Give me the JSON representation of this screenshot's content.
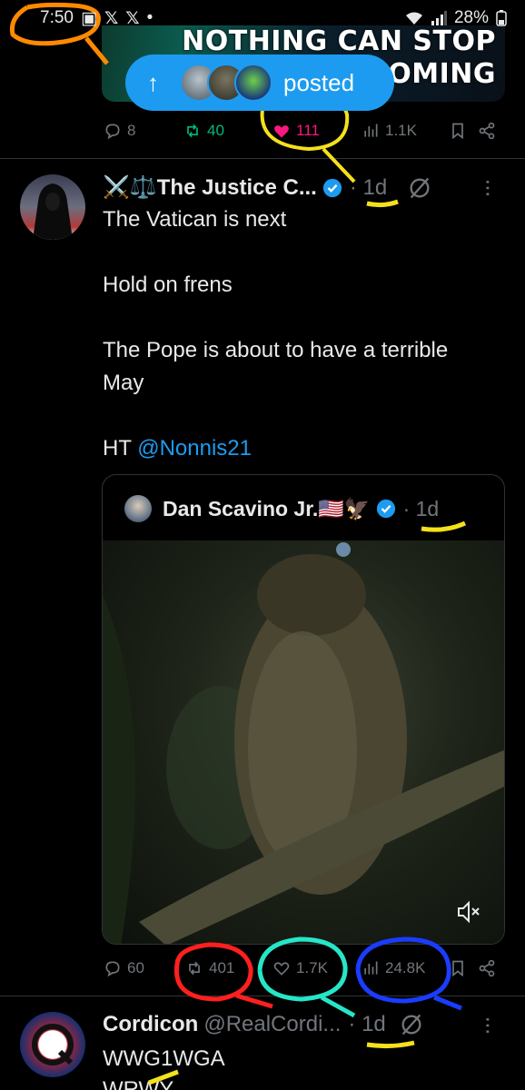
{
  "status_bar": {
    "time": "7:50",
    "battery": "28%"
  },
  "previous_post": {
    "banner_lines": [
      "NOTHING CAN STOP",
      "COMING"
    ],
    "replies": "8",
    "reposts": "40",
    "likes": "111",
    "views": "1.1K"
  },
  "posted_pill": {
    "label": "posted"
  },
  "tweet": {
    "display_name": "⚔️⚖️The Justice C...",
    "time": "· 1d",
    "text_lines": [
      "The Vatican is next",
      "Hold on frens",
      "The Pope is about to have a terrible May"
    ],
    "ht_prefix": "HT",
    "ht_mention": "@Nonnis21",
    "quote": {
      "display_name": "Dan Scavino Jr.🇺🇸🦅",
      "time": "· 1d"
    },
    "replies": "60",
    "reposts": "401",
    "likes": "1.7K",
    "views": "24.8K"
  },
  "next_tweet": {
    "display_name": "Cordicon",
    "handle": "@RealCordi...",
    "time": "· 1d",
    "text": "WWG1WGA",
    "text2": "WRWY"
  },
  "colors": {
    "accent": "#1d9bf0",
    "like_active": "#f91880",
    "muted": "#71767b",
    "background": "#000000"
  }
}
